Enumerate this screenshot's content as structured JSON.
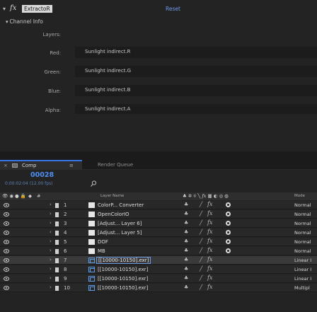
{
  "effect": {
    "name": "ExtractoR",
    "fx_glyph": "fx",
    "reset_label": "Reset",
    "section_label": "Channel Info",
    "layers_label": "Layers:",
    "channels": [
      {
        "label": "Red:",
        "value": "Sunlight indirect.R"
      },
      {
        "label": "Green:",
        "value": "Sunlight indirect.G"
      },
      {
        "label": "Blue:",
        "value": "Sunlight indirect.B"
      },
      {
        "label": "Alpha:",
        "value": "Sunlight indirect.A"
      }
    ]
  },
  "tabs": {
    "comp_label": "Comp",
    "render_queue_label": "Render Queue",
    "close_glyph": "×",
    "menu_glyph": "≡"
  },
  "timeline": {
    "timecode": "00028",
    "timecode_sub": "0:00:02:04 (12.00 fps)",
    "header": {
      "layer_name": "Layer Name",
      "mode": "Mode"
    }
  },
  "layers": [
    {
      "num": "1",
      "type": "solid",
      "name": "ColorP... Converter",
      "mode": "Normal",
      "selected": false,
      "boxed": false
    },
    {
      "num": "2",
      "type": "solid",
      "name": "OpenColorIO",
      "mode": "Normal",
      "selected": false,
      "boxed": false
    },
    {
      "num": "3",
      "type": "solid",
      "name": "[Adjust... Layer 6]",
      "mode": "Normal",
      "selected": false,
      "boxed": false
    },
    {
      "num": "4",
      "type": "solid",
      "name": "[Adjust... Layer 5]",
      "mode": "Normal",
      "selected": false,
      "boxed": false
    },
    {
      "num": "5",
      "type": "solid",
      "name": "DOF",
      "mode": "Normal",
      "selected": false,
      "boxed": false
    },
    {
      "num": "6",
      "type": "solid",
      "name": "MB",
      "mode": "Normal",
      "selected": false,
      "boxed": false
    },
    {
      "num": "7",
      "type": "footage",
      "name": "[[10000-10150].exr]",
      "mode": "Linear I",
      "selected": true,
      "boxed": true
    },
    {
      "num": "8",
      "type": "footage",
      "name": "[[10000-10150].exr]",
      "mode": "Linear I",
      "selected": false,
      "boxed": false
    },
    {
      "num": "9",
      "type": "footage",
      "name": "[[10000-10150].exr]",
      "mode": "Linear I",
      "selected": false,
      "boxed": false
    },
    {
      "num": "10",
      "type": "footage",
      "name": "[[10000-10150].exr]",
      "mode": "Multipl",
      "selected": false,
      "boxed": false
    }
  ],
  "icons": {
    "eye": "eye-icon",
    "shy": "shy-icon",
    "fx": "fx-icon",
    "search": "search-icon"
  },
  "colors": {
    "accent": "#3578e5",
    "timecode": "#4f8ff3",
    "reset": "#6f9bea"
  }
}
